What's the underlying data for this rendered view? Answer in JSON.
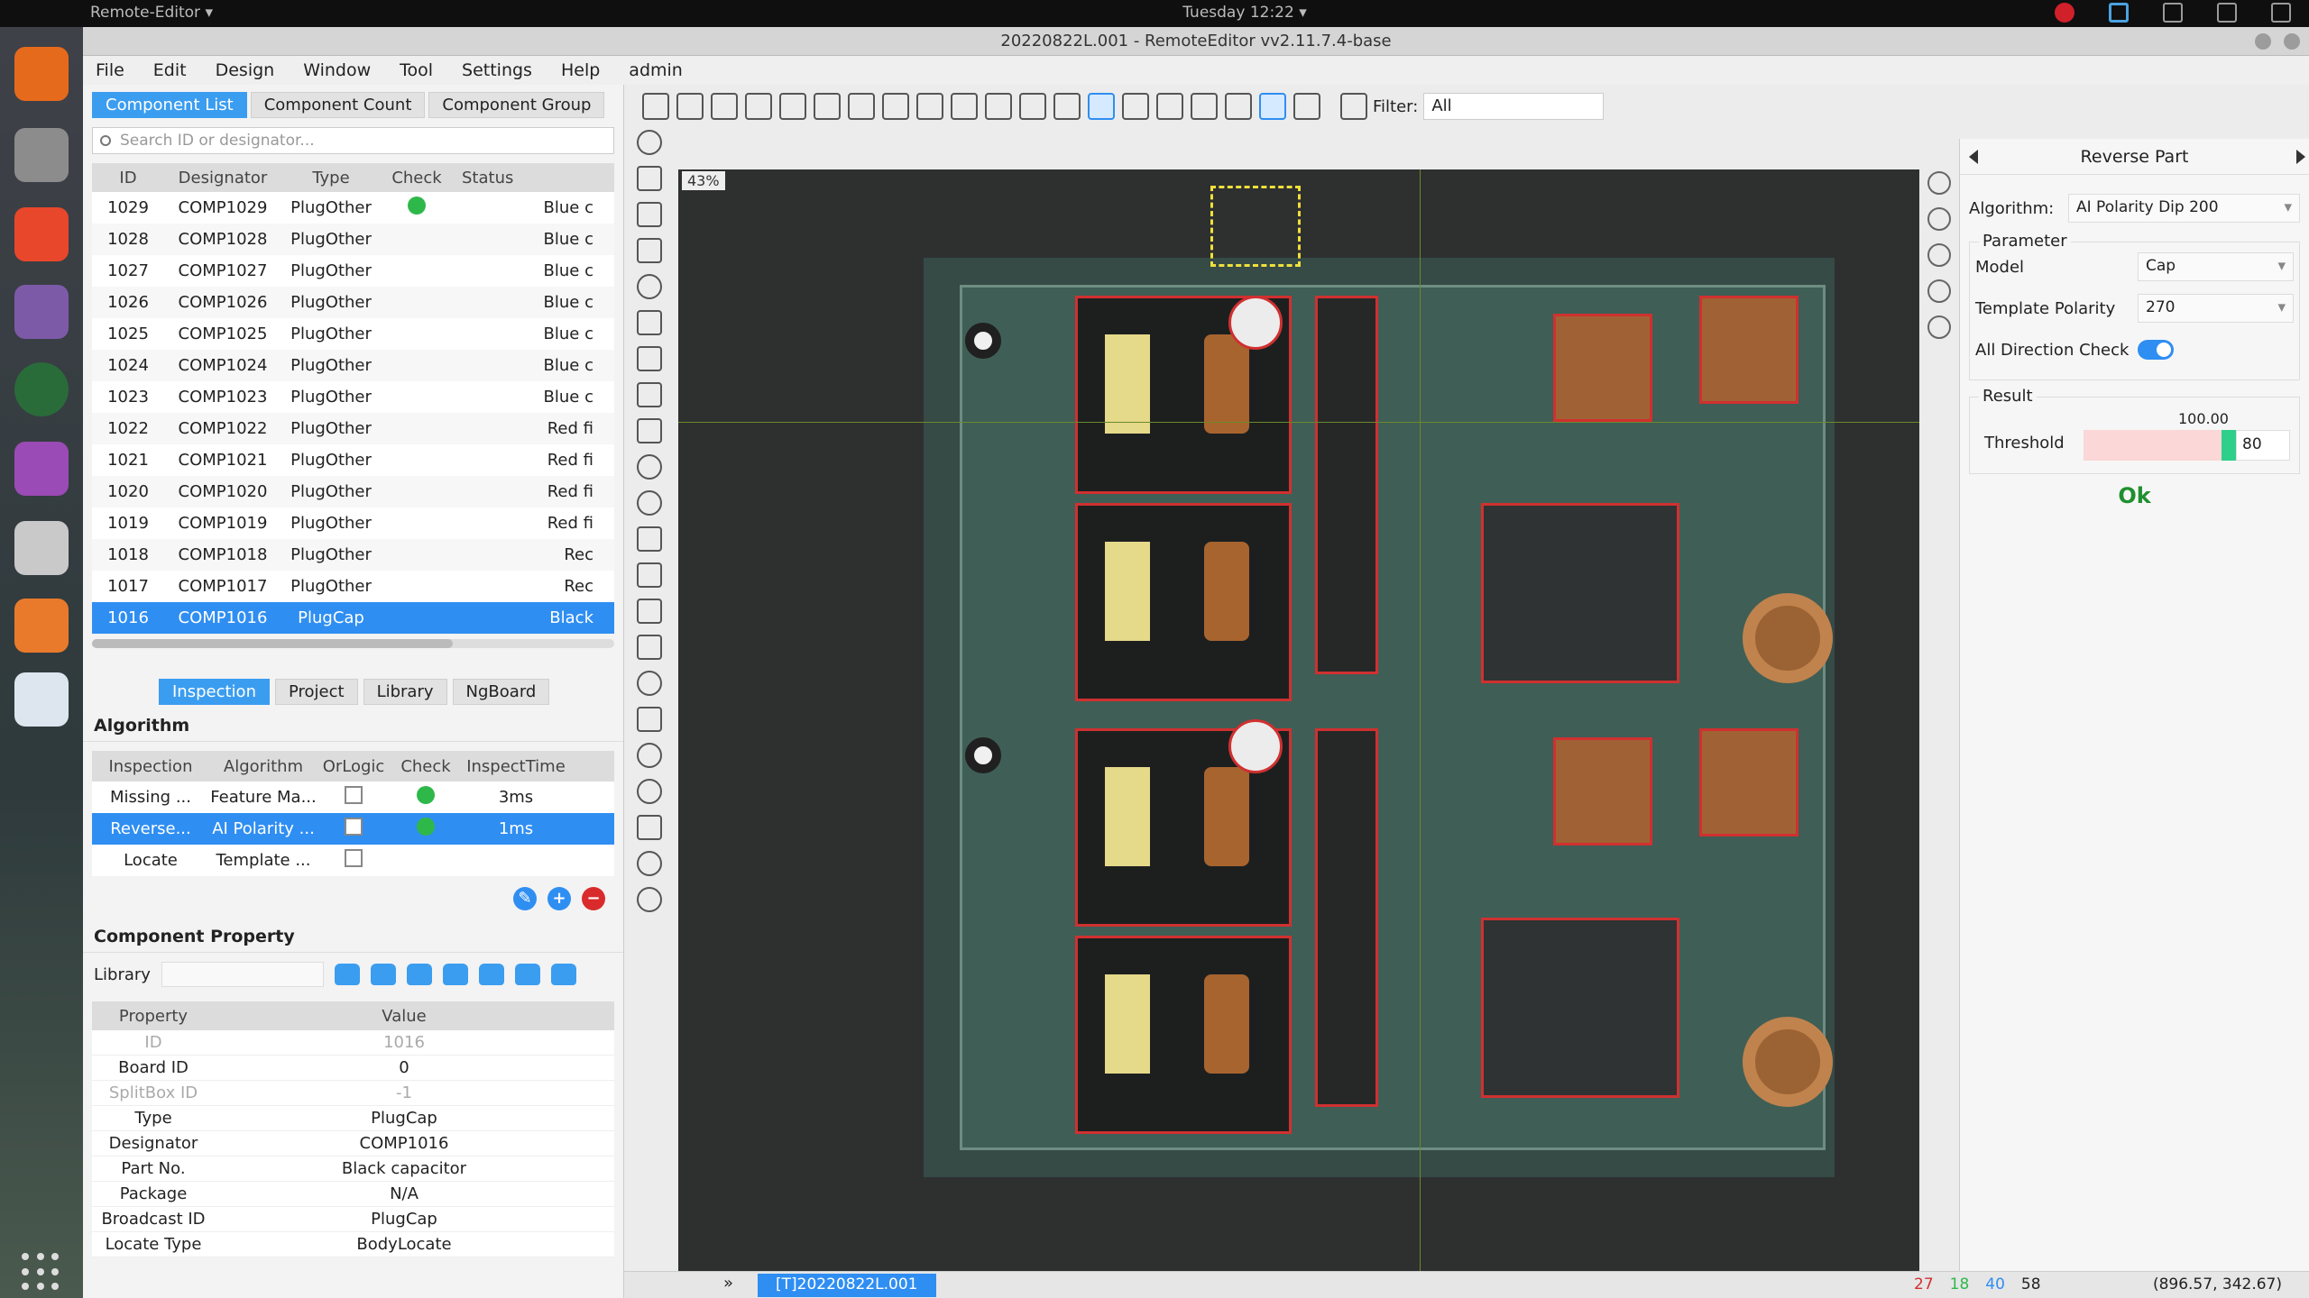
{
  "system": {
    "activity": "Remote-Editor ▾",
    "clock": "Tuesday 12:22 ▾"
  },
  "window": {
    "title": "20220822L.001 - RemoteEditor vv2.11.7.4-base"
  },
  "menu": [
    "File",
    "Edit",
    "Design",
    "Window",
    "Tool",
    "Settings",
    "Help",
    "admin"
  ],
  "left": {
    "tabs": [
      "Component List",
      "Component Count",
      "Component Group"
    ],
    "search_placeholder": "Search ID or designator...",
    "columns": [
      "ID",
      "Designator",
      "Type",
      "Check",
      "Status"
    ],
    "rows": [
      {
        "id": "1029",
        "designator": "COMP1029",
        "type": "PlugOther",
        "check": true,
        "status": "Blue c"
      },
      {
        "id": "1028",
        "designator": "COMP1028",
        "type": "PlugOther",
        "check": false,
        "status": "Blue c"
      },
      {
        "id": "1027",
        "designator": "COMP1027",
        "type": "PlugOther",
        "check": false,
        "status": "Blue c"
      },
      {
        "id": "1026",
        "designator": "COMP1026",
        "type": "PlugOther",
        "check": false,
        "status": "Blue c"
      },
      {
        "id": "1025",
        "designator": "COMP1025",
        "type": "PlugOther",
        "check": false,
        "status": "Blue c"
      },
      {
        "id": "1024",
        "designator": "COMP1024",
        "type": "PlugOther",
        "check": false,
        "status": "Blue c"
      },
      {
        "id": "1023",
        "designator": "COMP1023",
        "type": "PlugOther",
        "check": false,
        "status": "Blue c"
      },
      {
        "id": "1022",
        "designator": "COMP1022",
        "type": "PlugOther",
        "check": false,
        "status": "Red fi"
      },
      {
        "id": "1021",
        "designator": "COMP1021",
        "type": "PlugOther",
        "check": false,
        "status": "Red fi"
      },
      {
        "id": "1020",
        "designator": "COMP1020",
        "type": "PlugOther",
        "check": false,
        "status": "Red fi"
      },
      {
        "id": "1019",
        "designator": "COMP1019",
        "type": "PlugOther",
        "check": false,
        "status": "Red fi"
      },
      {
        "id": "1018",
        "designator": "COMP1018",
        "type": "PlugOther",
        "check": false,
        "status": "Rec"
      },
      {
        "id": "1017",
        "designator": "COMP1017",
        "type": "PlugOther",
        "check": false,
        "status": "Rec"
      },
      {
        "id": "1016",
        "designator": "COMP1016",
        "type": "PlugCap",
        "check": false,
        "status": "Black"
      }
    ],
    "lower_tabs": [
      "Inspection",
      "Project",
      "Library",
      "NgBoard"
    ],
    "algorithm_title": "Algorithm",
    "algo_columns": [
      "Inspection",
      "Algorithm",
      "OrLogic",
      "Check",
      "InspectTime"
    ],
    "algo_rows": [
      {
        "inspection": "Missing ...",
        "algorithm": "Feature Ma...",
        "check": true,
        "time": "3ms"
      },
      {
        "inspection": "Reverse...",
        "algorithm": "AI Polarity ...",
        "check": true,
        "time": "1ms"
      },
      {
        "inspection": "Locate",
        "algorithm": "Template ...",
        "check": false,
        "time": ""
      }
    ],
    "component_property_title": "Component Property",
    "library_label": "Library",
    "prop_columns": [
      "Property",
      "Value"
    ],
    "props": [
      {
        "k": "ID",
        "v": "1016",
        "dim": true
      },
      {
        "k": "Board ID",
        "v": "0",
        "dim": false
      },
      {
        "k": "SplitBox ID",
        "v": "-1",
        "dim": true
      },
      {
        "k": "Type",
        "v": "PlugCap",
        "dim": false
      },
      {
        "k": "Designator",
        "v": "COMP1016",
        "dim": false
      },
      {
        "k": "Part No.",
        "v": "Black capacitor",
        "dim": false
      },
      {
        "k": "Package",
        "v": "N/A",
        "dim": false
      },
      {
        "k": "Broadcast ID",
        "v": "PlugCap",
        "dim": false
      },
      {
        "k": "Locate Type",
        "v": "BodyLocate",
        "dim": false
      }
    ]
  },
  "toolbar": {
    "filter_label": "Filter:",
    "filter_value": "All"
  },
  "canvas": {
    "zoom": "43%"
  },
  "right": {
    "title": "Reverse Part",
    "algorithm_label": "Algorithm:",
    "algorithm_value": "AI Polarity Dip 200",
    "parameter_title": "Parameter",
    "model_label": "Model",
    "model_value": "Cap",
    "template_label": "Template Polarity",
    "template_value": "270",
    "direction_label": "All Direction Check",
    "result_title": "Result",
    "threshold_label": "Threshold",
    "threshold_score": "100.00",
    "threshold_value": "80",
    "threshold_fraction": 0.8,
    "ok_label": "Ok"
  },
  "status": {
    "tab": "[T]20220822L.001",
    "counts": [
      "27",
      "18",
      "40",
      "58"
    ],
    "coord": "(896.57, 342.67)"
  },
  "colors": {
    "accent": "#2f8ef2",
    "ok": "#2fb84a",
    "defect_box": "#d03030"
  }
}
